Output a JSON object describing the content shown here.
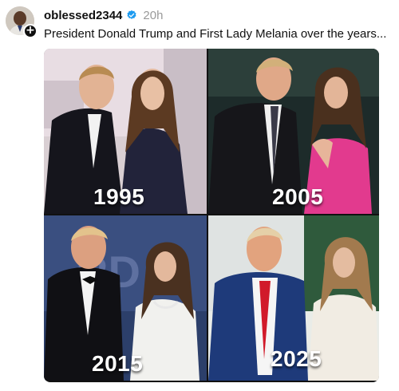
{
  "post": {
    "username": "oblessed2344",
    "timestamp": "20h",
    "caption": "President Donald Trump and First Lady Melania over the years...",
    "verified": true
  },
  "icons": {
    "avatar": "profile-avatar",
    "follow": "plus-icon",
    "verified": "verified-badge-icon"
  },
  "follow_glyph": "+",
  "colors": {
    "verified_blue": "#1d9bf0",
    "timestamp_gray": "#999999",
    "text": "#101010"
  },
  "photos": [
    {
      "year": "1995"
    },
    {
      "year": "2005"
    },
    {
      "year": "2015"
    },
    {
      "year": "2025"
    }
  ]
}
